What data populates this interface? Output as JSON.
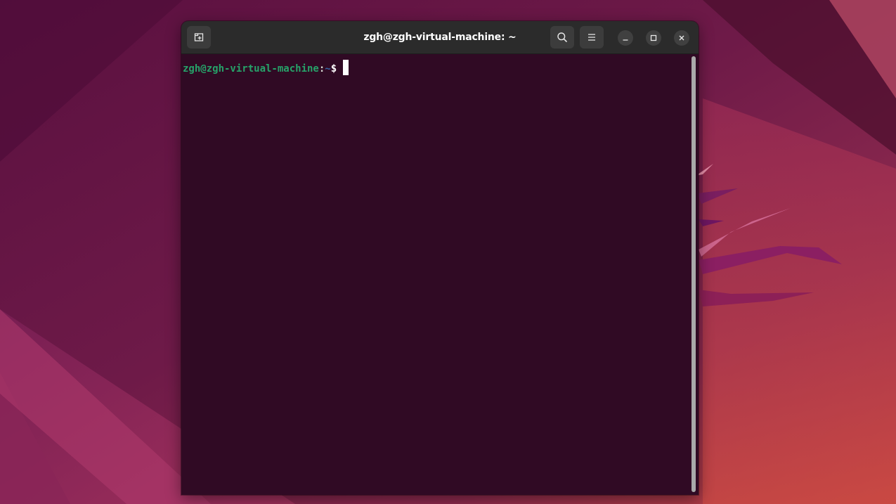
{
  "window": {
    "title": "zgh@zgh-virtual-machine: ~"
  },
  "toolbar": {
    "new_tab_icon": "new-tab-icon",
    "search_icon": "search-icon",
    "menu_icon": "hamburger-menu-icon",
    "minimize_icon": "minimize-icon",
    "maximize_icon": "maximize-icon",
    "close_icon": "close-icon"
  },
  "terminal": {
    "prompt_user_host": "zgh@zgh-virtual-machine",
    "prompt_colon": ":",
    "prompt_path": "~",
    "prompt_symbol": "$"
  },
  "colors": {
    "terminal_bg": "#300a24",
    "titlebar_bg": "#2b2b2b",
    "prompt_user": "#26a269",
    "prompt_path": "#3465a4",
    "desktop_accent": "#c24a4a"
  }
}
